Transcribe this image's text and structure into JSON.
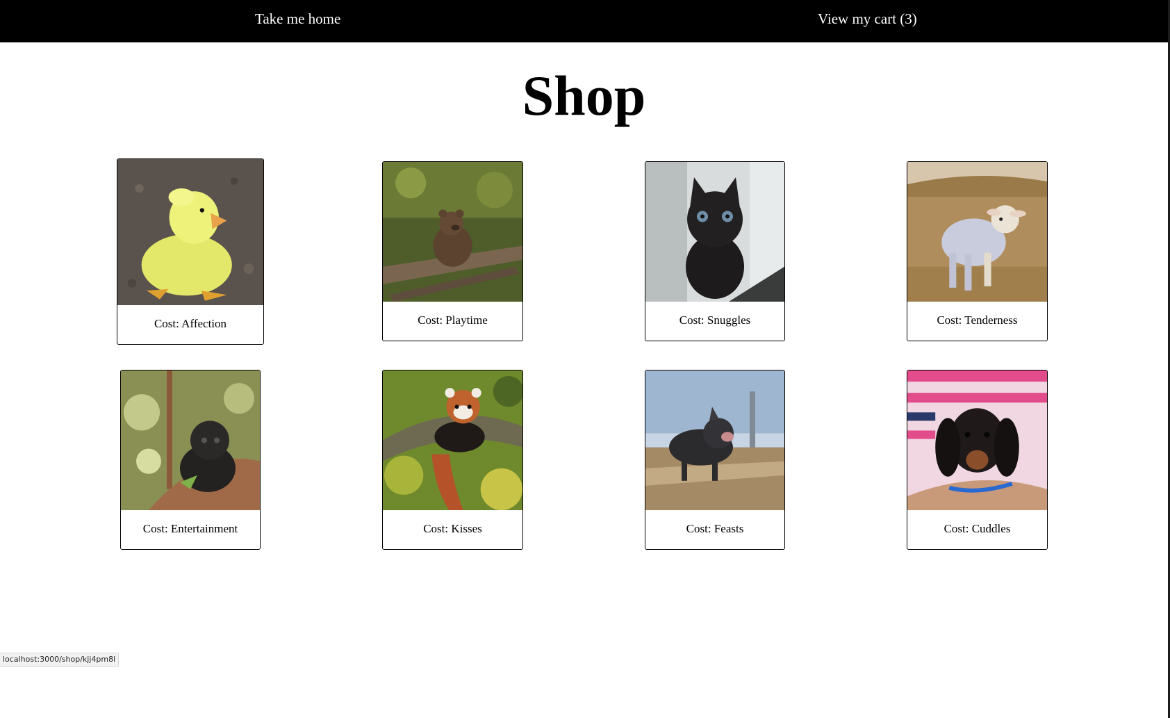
{
  "nav": {
    "home_label": "Take me home",
    "cart_label": "View my cart (3)"
  },
  "page": {
    "title": "Shop"
  },
  "products": [
    {
      "animal": "duckling",
      "cost": "Cost: Affection"
    },
    {
      "animal": "bear cub",
      "cost": "Cost: Playtime"
    },
    {
      "animal": "kitten",
      "cost": "Cost: Snuggles"
    },
    {
      "animal": "lamb",
      "cost": "Cost: Tenderness"
    },
    {
      "animal": "baby monkey",
      "cost": "Cost: Entertainment"
    },
    {
      "animal": "red panda",
      "cost": "Cost: Kisses"
    },
    {
      "animal": "piglet",
      "cost": "Cost: Feasts"
    },
    {
      "animal": "dachshund puppy",
      "cost": "Cost: Cuddles"
    }
  ],
  "status_bar": {
    "url": "localhost:3000/shop/kjj4pm8l"
  },
  "colors": {
    "nav_background": "#000000",
    "nav_text": "#ffffff",
    "page_background": "#ffffff",
    "card_border": "#000000"
  }
}
